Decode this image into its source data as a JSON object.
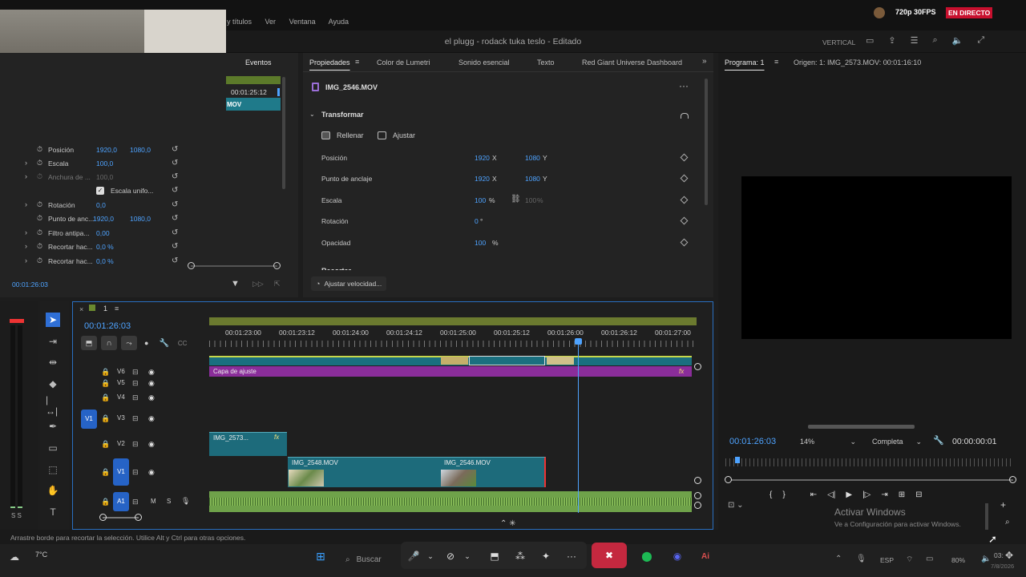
{
  "stream": {
    "quality": "720p 30FPS",
    "live": "EN DIRECTO"
  },
  "menu": {
    "items": [
      "y títulos",
      "Ver",
      "Ventana",
      "Ayuda"
    ]
  },
  "title": "el plugg - rodack tuka teslo - Editado",
  "header_right": {
    "vertical": "VERTICAL"
  },
  "left_panel": {
    "tab": "Eventos",
    "timecode": "00:01:25:12",
    "clip_label": "MOV",
    "rows": [
      {
        "name": "Posición",
        "v1": "1920,0",
        "v2": "1080,0"
      },
      {
        "name": "Escala",
        "v1": "100,0",
        "v2": ""
      },
      {
        "name": "Anchura de ...",
        "v1": "100,0",
        "v2": ""
      },
      {
        "name": "Escala unifo...",
        "v1": "",
        "v2": ""
      },
      {
        "name": "Rotación",
        "v1": "0,0",
        "v2": ""
      },
      {
        "name": "Punto de anc...",
        "v1": "1920,0",
        "v2": "1080,0"
      },
      {
        "name": "Filtro antipa...",
        "v1": "0,00",
        "v2": ""
      },
      {
        "name": "Recortar hac...",
        "v1": "0,0 %",
        "v2": ""
      },
      {
        "name": "Recortar hac...",
        "v1": "0,0 %",
        "v2": ""
      }
    ],
    "footer_timecode": "00:01:26:03"
  },
  "props": {
    "tabs": [
      "Propiedades",
      "Color de Lumetri",
      "Sonido esencial",
      "Texto",
      "Red Giant Universe Dashboard"
    ],
    "clip_name": "IMG_2546.MOV",
    "section": "Transformar",
    "fill": "Rellenar",
    "fit": "Ajustar",
    "rows": [
      {
        "name": "Posición",
        "x": "1920",
        "xu": "X",
        "y": "1080",
        "yu": "Y"
      },
      {
        "name": "Punto de anclaje",
        "x": "1920",
        "xu": "X",
        "y": "1080",
        "yu": "Y"
      },
      {
        "name": "Escala",
        "x": "100",
        "xu": "%",
        "y": "100",
        "yu": "%"
      },
      {
        "name": "Rotación",
        "x": "0",
        "xu": "°",
        "y": "",
        "yu": ""
      },
      {
        "name": "Opacidad",
        "x": "100",
        "xu": "%",
        "y": "",
        "yu": ""
      }
    ],
    "next_section": "Recortar",
    "speed_button": "Ajustar velocidad..."
  },
  "program": {
    "tab": "Programa: 1",
    "source": "Origen: 1: IMG_2573.MOV: 00:01:16:10",
    "timecode": "00:01:26:03",
    "zoom": "14%",
    "quality": "Completa",
    "duration": "00:00:00:01"
  },
  "timeline": {
    "seq_name": "1",
    "timecode": "00:01:26:03",
    "ruler": [
      "00:01:23:00",
      "00:01:23:12",
      "00:01:24:00",
      "00:01:24:12",
      "00:01:25:00",
      "00:01:25:12",
      "00:01:26:00",
      "00:01:26:12",
      "00:01:27:00"
    ],
    "tracks": [
      "V6",
      "V5",
      "V4",
      "V3",
      "V2",
      "V1",
      "A1"
    ],
    "src_v1": "V1",
    "src_a1": "A1",
    "adjust_layer": "Capa de ajuste",
    "clips": {
      "v2": "IMG_2573...",
      "v1a": "IMG_2548.MOV",
      "v1b": "IMG_2546.MOV"
    },
    "fx": "fx",
    "mute": "M",
    "solo": "S"
  },
  "status": "Arrastre borde para recortar la selección. Utilice Alt y Ctrl para otras opciones.",
  "watermark": {
    "title": "Activar Windows",
    "sub": "Ve a Configuración para activar Windows."
  },
  "taskbar": {
    "search": "Buscar",
    "weather": "7°C",
    "lang": "ESP",
    "battery": "80%",
    "time": "03:",
    "date": "7/8/2026"
  },
  "meter": {
    "labels": "S S"
  }
}
